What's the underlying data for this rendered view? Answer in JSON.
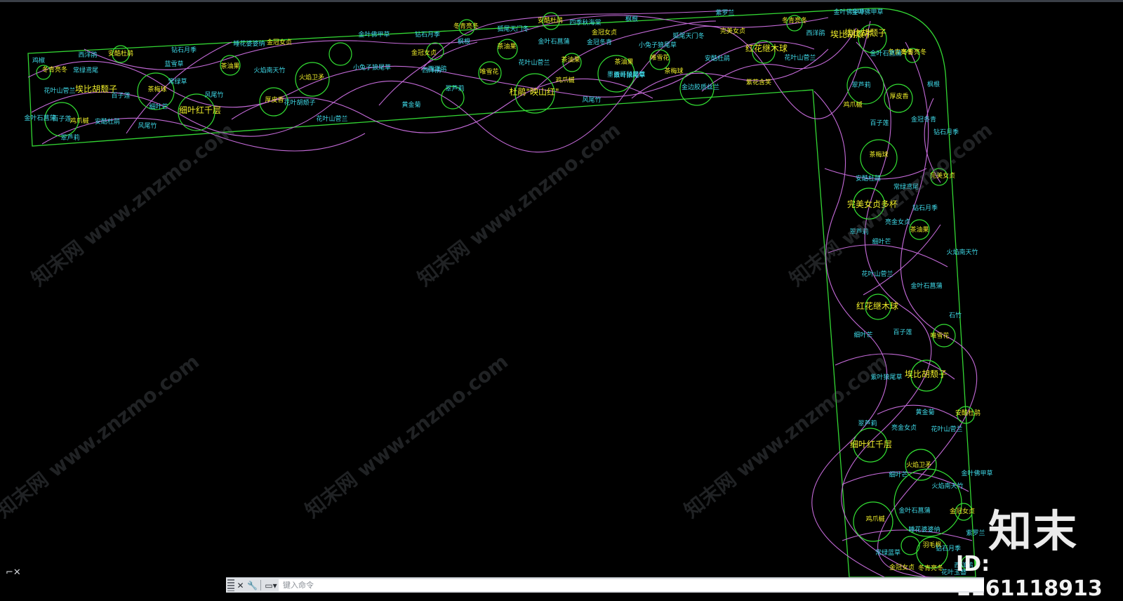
{
  "colors": {
    "background": "#000000",
    "boundary": "#33d633",
    "curves": "#c46ad8",
    "circles": "#33e033",
    "label_cyan": "#3fd9e8",
    "label_yellow": "#f0ee2a"
  },
  "icons": {
    "ucs": "ucs-close-icon",
    "cmd_close": "close-icon",
    "cmd_settings": "wrench-icon",
    "cmd_history": "command-history-icon"
  },
  "command_line": {
    "placeholder": "键入命令",
    "close_glyph": "✕",
    "wrench_glyph": "🔧",
    "history_glyph": "▭▾"
  },
  "ucs_glyph": "⌐✕",
  "watermark": {
    "logo": "知末",
    "id_text": "ID: 1161118913",
    "site": "知末网 www.znzmo.com"
  },
  "labels": {
    "top": [
      {
        "t": "鸡椒",
        "c": "cyan"
      },
      {
        "t": "西洋鹃",
        "c": "cyan"
      },
      {
        "t": "安酷杜鹃",
        "c": "yellow"
      },
      {
        "t": "钻石月季",
        "c": "cyan"
      },
      {
        "t": "睡花婆婆纳",
        "c": "cyan"
      },
      {
        "t": "金冠女贞",
        "c": "yellow"
      },
      {
        "t": "金叶佛甲草",
        "c": "cyan"
      },
      {
        "t": "钻石月季",
        "c": "cyan"
      },
      {
        "t": "冬青亮冬",
        "c": "yellow"
      },
      {
        "t": "狐尾天门冬",
        "c": "cyan"
      },
      {
        "t": "安酷杜鹃",
        "c": "yellow"
      },
      {
        "t": "四季秋海棠",
        "c": "cyan"
      },
      {
        "t": "金冠女贞",
        "c": "yellow"
      },
      {
        "t": "枫根",
        "c": "cyan"
      },
      {
        "t": "紫罗兰",
        "c": "cyan"
      },
      {
        "t": "冬青亮冬",
        "c": "yellow"
      },
      {
        "t": "金叶佛甲草",
        "c": "cyan"
      },
      {
        "t": "冬青亮冬",
        "c": "yellow"
      },
      {
        "t": "常绿鸢尾",
        "c": "cyan"
      },
      {
        "t": "蓝雪草",
        "c": "cyan"
      },
      {
        "t": "茶油果",
        "c": "yellow"
      },
      {
        "t": "火焰南天竹",
        "c": "cyan"
      },
      {
        "t": "茶油果",
        "c": "yellow"
      },
      {
        "t": "金冠女贞",
        "c": "yellow"
      },
      {
        "t": "西洋鹃",
        "c": "cyan"
      },
      {
        "t": "枫根",
        "c": "cyan"
      },
      {
        "t": "茶油果",
        "c": "yellow"
      },
      {
        "t": "金叶石菖蒲",
        "c": "cyan"
      },
      {
        "t": "金冠冬青",
        "c": "cyan"
      },
      {
        "t": "小兔子狼尾草",
        "c": "cyan"
      },
      {
        "t": "狐尾天门冬",
        "c": "cyan"
      },
      {
        "t": "完美女贞",
        "c": "yellow"
      },
      {
        "t": "西洋鹃",
        "c": "cyan"
      },
      {
        "t": "埃比胡颓子",
        "c": "yellow"
      },
      {
        "t": "花叶山菅兰",
        "c": "cyan"
      },
      {
        "t": "埃比胡颓子",
        "c": "yellow"
      },
      {
        "t": "冬青亮冬",
        "c": "yellow"
      },
      {
        "t": "百子莲",
        "c": "cyan"
      },
      {
        "t": "常绿草",
        "c": "cyan"
      },
      {
        "t": "茶梅球",
        "c": "yellow"
      },
      {
        "t": "风尾竹",
        "c": "cyan"
      },
      {
        "t": "细叶芒",
        "c": "cyan"
      },
      {
        "t": "细叶红千层",
        "c": "yellow"
      },
      {
        "t": "厚皮香",
        "c": "yellow"
      },
      {
        "t": "火焰卫矛",
        "c": "yellow"
      },
      {
        "t": "小兔子狼尾草",
        "c": "cyan"
      },
      {
        "t": "西洋鹃",
        "c": "cyan"
      },
      {
        "t": "唯雪花",
        "c": "yellow"
      },
      {
        "t": "花叶山菅兰",
        "c": "cyan"
      },
      {
        "t": "茶油果",
        "c": "yellow"
      },
      {
        "t": "紫叶狼尾草",
        "c": "cyan"
      },
      {
        "t": "唯雪花",
        "c": "yellow"
      },
      {
        "t": "安酷杜鹃",
        "c": "cyan"
      },
      {
        "t": "红花继木球",
        "c": "yellow"
      },
      {
        "t": "花叶山菅兰",
        "c": "cyan"
      },
      {
        "t": "金叶石菖蒲",
        "c": "cyan"
      },
      {
        "t": "百子莲",
        "c": "cyan"
      },
      {
        "t": "鸡爪槭",
        "c": "yellow"
      },
      {
        "t": "安酷杜鹃",
        "c": "cyan"
      },
      {
        "t": "风尾竹",
        "c": "cyan"
      },
      {
        "t": "翠芦莉",
        "c": "cyan"
      },
      {
        "t": "花叶胡颓子",
        "c": "cyan"
      },
      {
        "t": "花叶山菅兰",
        "c": "cyan"
      },
      {
        "t": "黄金菊",
        "c": "cyan"
      },
      {
        "t": "翠芦莉",
        "c": "cyan"
      },
      {
        "t": "杜鹃\"映山红\"",
        "c": "yellow"
      },
      {
        "t": "鸡爪槭",
        "c": "yellow"
      },
      {
        "t": "风尾竹",
        "c": "cyan"
      },
      {
        "t": "墨西哥鼠尾草",
        "c": "cyan"
      },
      {
        "t": "茶梅球",
        "c": "yellow"
      },
      {
        "t": "金边胶质丝兰",
        "c": "cyan"
      },
      {
        "t": "紫花含笑",
        "c": "yellow"
      },
      {
        "t": "翠芦莉",
        "c": "cyan"
      },
      {
        "t": "鸡爪槭",
        "c": "yellow"
      },
      {
        "t": "细叶芒",
        "c": "cyan"
      }
    ],
    "right": [
      {
        "t": "金叶佛甲草",
        "c": "cyan"
      },
      {
        "t": "埃比胡颓子",
        "c": "yellow"
      },
      {
        "t": "金叶石菖蒲",
        "c": "cyan"
      },
      {
        "t": "冬青亮冬",
        "c": "yellow"
      },
      {
        "t": "枫根",
        "c": "cyan"
      },
      {
        "t": "厚皮香",
        "c": "yellow"
      },
      {
        "t": "金冠冬青",
        "c": "cyan"
      },
      {
        "t": "百子莲",
        "c": "cyan"
      },
      {
        "t": "钻石月季",
        "c": "cyan"
      },
      {
        "t": "茶梅球",
        "c": "yellow"
      },
      {
        "t": "完美女贞",
        "c": "yellow"
      },
      {
        "t": "安酷杜鹃",
        "c": "cyan"
      },
      {
        "t": "常绿鸢尾",
        "c": "cyan"
      },
      {
        "t": "完美女贞多杯",
        "c": "yellow"
      },
      {
        "t": "钻石月季",
        "c": "cyan"
      },
      {
        "t": "亮金女贞",
        "c": "cyan"
      },
      {
        "t": "翠芦莉",
        "c": "cyan"
      },
      {
        "t": "茶油果",
        "c": "yellow"
      },
      {
        "t": "细叶芒",
        "c": "cyan"
      },
      {
        "t": "火焰南天竹",
        "c": "cyan"
      },
      {
        "t": "花叶山菅兰",
        "c": "cyan"
      },
      {
        "t": "金叶石菖蒲",
        "c": "cyan"
      },
      {
        "t": "红花继木球",
        "c": "yellow"
      },
      {
        "t": "石竹",
        "c": "cyan"
      },
      {
        "t": "细叶芒",
        "c": "cyan"
      },
      {
        "t": "百子莲",
        "c": "cyan"
      },
      {
        "t": "唯雪花",
        "c": "yellow"
      },
      {
        "t": "紫叶狼尾草",
        "c": "cyan"
      },
      {
        "t": "埃比胡颓子",
        "c": "yellow"
      },
      {
        "t": "黄金菊",
        "c": "cyan"
      },
      {
        "t": "安酷杜鹃",
        "c": "yellow"
      },
      {
        "t": "翠芦莉",
        "c": "cyan"
      },
      {
        "t": "亮金女贞",
        "c": "cyan"
      },
      {
        "t": "花叶山菅兰",
        "c": "cyan"
      },
      {
        "t": "细叶红千层",
        "c": "yellow"
      },
      {
        "t": "火焰卫矛",
        "c": "yellow"
      },
      {
        "t": "细叶芒",
        "c": "cyan"
      },
      {
        "t": "火焰南天竹",
        "c": "cyan"
      },
      {
        "t": "金叶佛甲草",
        "c": "cyan"
      },
      {
        "t": "鸡爪槭",
        "c": "yellow"
      },
      {
        "t": "金叶石菖蒲",
        "c": "cyan"
      },
      {
        "t": "金冠女贞",
        "c": "yellow"
      },
      {
        "t": "睡花婆婆纳",
        "c": "cyan"
      },
      {
        "t": "紫罗兰",
        "c": "cyan"
      },
      {
        "t": "常绿蓝草",
        "c": "cyan"
      },
      {
        "t": "羽毛枫",
        "c": "yellow"
      },
      {
        "t": "钻石月季",
        "c": "cyan"
      },
      {
        "t": "金冠女贞",
        "c": "yellow"
      },
      {
        "t": "花叶玉簪",
        "c": "cyan"
      },
      {
        "t": "西洋鹃",
        "c": "cyan"
      },
      {
        "t": "冬青亮冬",
        "c": "yellow"
      },
      {
        "t": "花叶山菅兰",
        "c": "cyan"
      },
      {
        "t": "火焰南天竹",
        "c": "cyan"
      }
    ]
  }
}
